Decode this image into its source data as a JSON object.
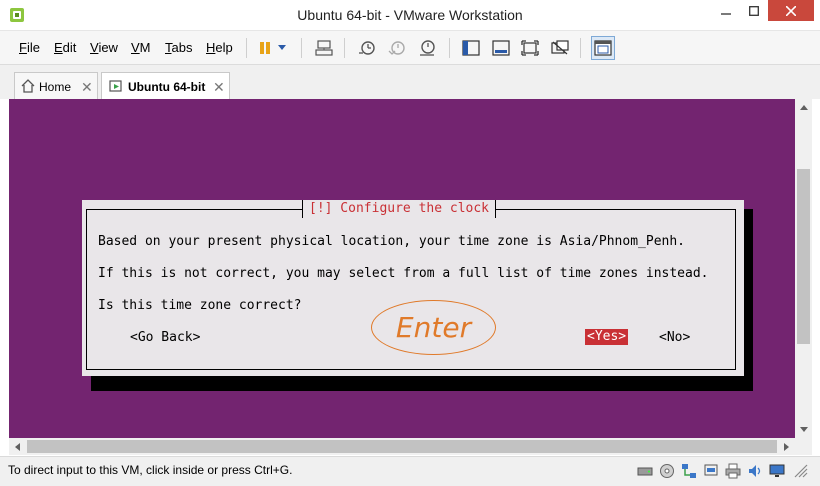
{
  "window": {
    "title": "Ubuntu 64-bit - VMware Workstation",
    "close_color": "#c9483c",
    "app_icon": "vmware-icon"
  },
  "menu": {
    "items": [
      {
        "id": "file",
        "first": "F",
        "rest": "ile"
      },
      {
        "id": "edit",
        "first": "E",
        "rest": "dit"
      },
      {
        "id": "view",
        "first": "V",
        "rest": "iew"
      },
      {
        "id": "vm",
        "first": "V",
        "rest": "M"
      },
      {
        "id": "tabs",
        "first": "T",
        "rest": "abs"
      },
      {
        "id": "help",
        "first": "H",
        "rest": "elp"
      }
    ]
  },
  "toolbar": {
    "icons": [
      "pause-icon",
      "dropdown-icon",
      "send-ctrl-alt-del-icon",
      "snapshot-icon",
      "revert-snapshot-icon",
      "snapshot-manager-icon",
      "show-library-icon",
      "quick-switch-icon",
      "full-screen-icon",
      "unity-icon",
      "console-view-icon"
    ]
  },
  "tabs": [
    {
      "label": "Home",
      "icon": "home-icon",
      "active": false
    },
    {
      "label": "Ubuntu 64-bit",
      "icon": "vm-icon",
      "active": true
    }
  ],
  "vm": {
    "background": "#732470",
    "dialog": {
      "title": "[!] Configure the clock",
      "line1": "Based on your present physical location, your time zone is Asia/Phnom_Penh.",
      "line2": "If this is not correct, you may select from a full list of time zones instead.",
      "line3": "Is this time zone correct?",
      "go_back": "<Go Back>",
      "yes": "<Yes>",
      "no": "<No>",
      "accent": "#c93035"
    },
    "annotation": "Enter"
  },
  "status": {
    "text": "To direct input to this VM, click inside or press Ctrl+G.",
    "icons": [
      "hard-disk-icon",
      "cd-dvd-icon",
      "network-icon",
      "usb-icon",
      "printer-icon",
      "sound-icon",
      "display-icon",
      "messages-icon"
    ]
  }
}
